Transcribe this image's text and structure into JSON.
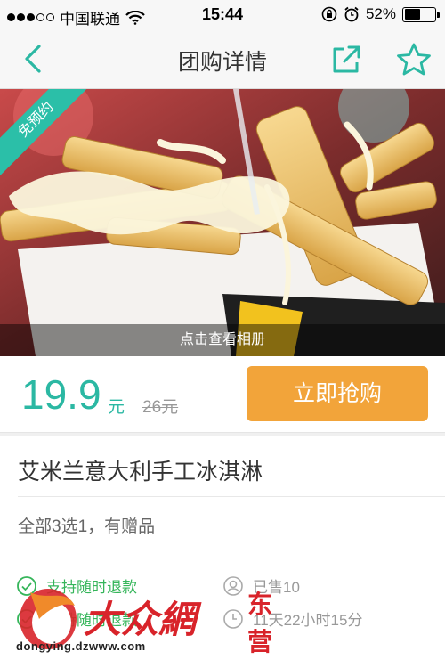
{
  "status_bar": {
    "carrier": "中国联通",
    "time": "15:44",
    "battery": "52%",
    "battery_level": 0.52
  },
  "nav": {
    "title": "团购详情",
    "back_icon": "chevron-left-icon",
    "share_icon": "share-external-icon",
    "favorite_icon": "star-outline-icon"
  },
  "hero": {
    "badge": "免预约",
    "album_link": "点击查看相册"
  },
  "price": {
    "current": "19.9",
    "unit": "元",
    "original": "26元",
    "buy_button": "立即抢购"
  },
  "product": {
    "title": "艾米兰意大利手工冰淇淋",
    "description": "全部3选1，有赠品"
  },
  "features": {
    "refund": "支持随时退款",
    "sold": "已售10",
    "anytime": "支持随时退款",
    "remaining": "11天22小时15分"
  },
  "watermark": {
    "logo_text": "大众網",
    "url": "dongying.dzwww.com",
    "city": "东营"
  },
  "colors": {
    "accent": "#2bb8a3",
    "buy_button": "#f2a43a",
    "feature_green": "#35b55a"
  }
}
